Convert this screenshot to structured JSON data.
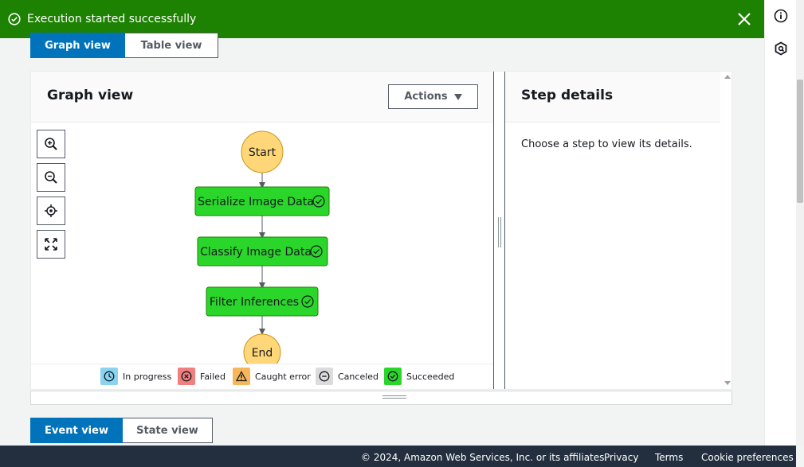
{
  "banner": {
    "message": "Execution started successfully",
    "color": "#1d8102"
  },
  "top_tabs": [
    {
      "label": "Graph view",
      "active": true
    },
    {
      "label": "Table view",
      "active": false
    }
  ],
  "graph": {
    "title": "Graph view",
    "actions_label": "Actions",
    "nodes": {
      "start": "Start",
      "step1": "Serialize Image Data",
      "step2": "Classify Image Data",
      "step3": "Filter Inferences",
      "end": "End"
    },
    "zoom_controls": [
      "zoom-in-icon",
      "zoom-out-icon",
      "center-icon",
      "fit-screen-icon"
    ],
    "legend": [
      {
        "label": "In progress",
        "color": "#8ad4f2"
      },
      {
        "label": "Failed",
        "color": "#f08080"
      },
      {
        "label": "Caught error",
        "color": "#f7b65a"
      },
      {
        "label": "Canceled",
        "color": "#dcdcdc"
      },
      {
        "label": "Succeeded",
        "color": "#2bd62b"
      }
    ]
  },
  "details": {
    "title": "Step details",
    "placeholder": "Choose a step to view its details."
  },
  "bottom_tabs": [
    {
      "label": "Event view",
      "active": true
    },
    {
      "label": "State view",
      "active": false
    }
  ],
  "footer": {
    "copyright": "© 2024, Amazon Web Services, Inc. or its affiliates.",
    "privacy": "Privacy",
    "terms": "Terms",
    "cookies": "Cookie preferences"
  },
  "colors": {
    "primary": "#0073bb",
    "success": "#2bd62b",
    "terminal_node": "#ffd778",
    "footer_bg": "#232f3e"
  }
}
